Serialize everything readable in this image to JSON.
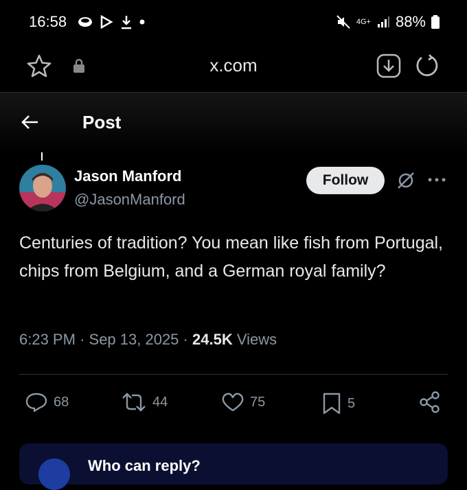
{
  "status_bar": {
    "time": "16:58",
    "battery": "88%",
    "network": "4G+"
  },
  "browser": {
    "url": "x.com"
  },
  "header": {
    "title": "Post"
  },
  "post": {
    "author_name": "Jason Manford",
    "handle": "@JasonManford",
    "follow_label": "Follow",
    "text": "Centuries of tradition? You mean like fish from Portugal, chips from Belgium, and a German royal family?",
    "time": "6:23 PM",
    "date": "Sep 13, 2025",
    "views_count": "24.5K",
    "views_label": "Views",
    "replies": "68",
    "reposts": "44",
    "likes": "75",
    "bookmarks": "5"
  },
  "reply_banner": {
    "title": "Who can reply?"
  },
  "colors": {
    "accent": "#1d9bf0",
    "muted": "#8b98a5",
    "text": "#e7e9ea",
    "banner_bg": "#0b1033"
  }
}
